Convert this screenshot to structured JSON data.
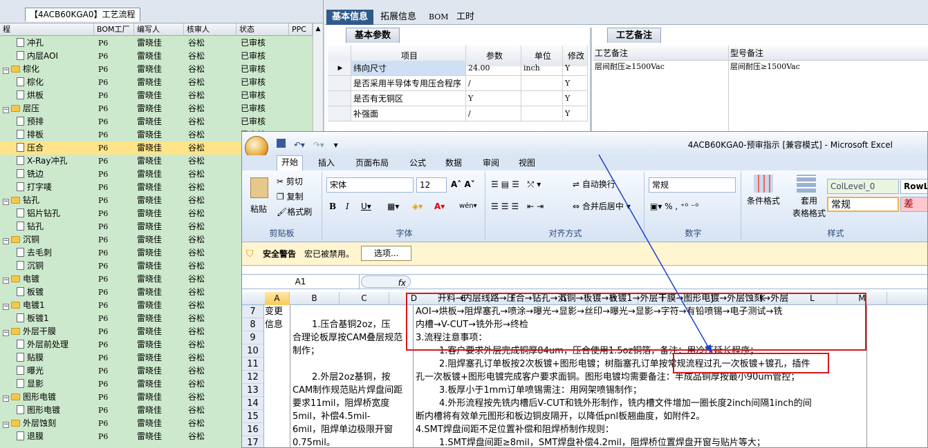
{
  "left_panel": {
    "title": "【4ACB60KGA0】工艺流程",
    "columns": [
      "程",
      "BOM工厂",
      "编写人",
      "核审人",
      "状态",
      "PPC"
    ],
    "rows": [
      {
        "name": "冲孔",
        "type": "doc",
        "indent": 2,
        "bom": "P6",
        "writer": "雷晓佳",
        "reviewer": "谷松",
        "status": "已审核"
      },
      {
        "name": "内层AOI",
        "type": "doc",
        "indent": 2,
        "bom": "P6",
        "writer": "雷晓佳",
        "reviewer": "谷松",
        "status": "已审核"
      },
      {
        "name": "棕化",
        "type": "folder",
        "indent": 1,
        "bom": "P6",
        "writer": "雷晓佳",
        "reviewer": "谷松",
        "status": "已审核"
      },
      {
        "name": "棕化",
        "type": "doc",
        "indent": 2,
        "bom": "P6",
        "writer": "雷晓佳",
        "reviewer": "谷松",
        "status": "已审核"
      },
      {
        "name": "烘板",
        "type": "doc",
        "indent": 2,
        "bom": "P6",
        "writer": "雷晓佳",
        "reviewer": "谷松",
        "status": "已审核"
      },
      {
        "name": "层压",
        "type": "folder",
        "indent": 1,
        "bom": "P6",
        "writer": "雷晓佳",
        "reviewer": "谷松",
        "status": "已审核"
      },
      {
        "name": "预排",
        "type": "doc",
        "indent": 2,
        "bom": "P6",
        "writer": "雷晓佳",
        "reviewer": "谷松",
        "status": "已审核"
      },
      {
        "name": "排板",
        "type": "doc",
        "indent": 2,
        "bom": "P6",
        "writer": "雷晓佳",
        "reviewer": "谷松",
        "status": "已审核"
      },
      {
        "name": "压合",
        "type": "doc",
        "indent": 2,
        "bom": "P6",
        "writer": "雷晓佳",
        "reviewer": "谷松",
        "status": "",
        "selected": true
      },
      {
        "name": "X-Ray冲孔",
        "type": "doc",
        "indent": 2,
        "bom": "P6",
        "writer": "雷晓佳",
        "reviewer": "谷松",
        "status": ""
      },
      {
        "name": "铣边",
        "type": "doc",
        "indent": 2,
        "bom": "P6",
        "writer": "雷晓佳",
        "reviewer": "谷松",
        "status": ""
      },
      {
        "name": "打字唛",
        "type": "doc",
        "indent": 2,
        "bom": "P6",
        "writer": "雷晓佳",
        "reviewer": "谷松",
        "status": ""
      },
      {
        "name": "钻孔",
        "type": "folder",
        "indent": 1,
        "bom": "P6",
        "writer": "雷晓佳",
        "reviewer": "谷松",
        "status": ""
      },
      {
        "name": "铝片钻孔",
        "type": "doc",
        "indent": 2,
        "bom": "P6",
        "writer": "雷晓佳",
        "reviewer": "谷松",
        "status": ""
      },
      {
        "name": "钻孔",
        "type": "doc",
        "indent": 2,
        "bom": "P6",
        "writer": "雷晓佳",
        "reviewer": "谷松",
        "status": ""
      },
      {
        "name": "沉铜",
        "type": "folder",
        "indent": 1,
        "bom": "P6",
        "writer": "雷晓佳",
        "reviewer": "谷松",
        "status": ""
      },
      {
        "name": "去毛刺",
        "type": "doc",
        "indent": 2,
        "bom": "P6",
        "writer": "雷晓佳",
        "reviewer": "谷松",
        "status": ""
      },
      {
        "name": "沉铜",
        "type": "doc",
        "indent": 2,
        "bom": "P6",
        "writer": "雷晓佳",
        "reviewer": "谷松",
        "status": ""
      },
      {
        "name": "电镀",
        "type": "folder",
        "indent": 1,
        "bom": "P6",
        "writer": "雷晓佳",
        "reviewer": "谷松",
        "status": ""
      },
      {
        "name": "板镀",
        "type": "doc",
        "indent": 2,
        "bom": "P6",
        "writer": "雷晓佳",
        "reviewer": "谷松",
        "status": ""
      },
      {
        "name": "电镀1",
        "type": "folder",
        "indent": 1,
        "bom": "P6",
        "writer": "雷晓佳",
        "reviewer": "谷松",
        "status": ""
      },
      {
        "name": "板镀1",
        "type": "doc",
        "indent": 2,
        "bom": "P6",
        "writer": "雷晓佳",
        "reviewer": "谷松",
        "status": ""
      },
      {
        "name": "外层干膜",
        "type": "folder",
        "indent": 1,
        "bom": "P6",
        "writer": "雷晓佳",
        "reviewer": "谷松",
        "status": ""
      },
      {
        "name": "外层前处理",
        "type": "doc",
        "indent": 2,
        "bom": "P6",
        "writer": "雷晓佳",
        "reviewer": "谷松",
        "status": ""
      },
      {
        "name": "贴膜",
        "type": "doc",
        "indent": 2,
        "bom": "P6",
        "writer": "雷晓佳",
        "reviewer": "谷松",
        "status": ""
      },
      {
        "name": "曝光",
        "type": "doc",
        "indent": 2,
        "bom": "P6",
        "writer": "雷晓佳",
        "reviewer": "谷松",
        "status": ""
      },
      {
        "name": "显影",
        "type": "doc",
        "indent": 2,
        "bom": "P6",
        "writer": "雷晓佳",
        "reviewer": "谷松",
        "status": ""
      },
      {
        "name": "图形电镀",
        "type": "folder",
        "indent": 1,
        "bom": "P6",
        "writer": "雷晓佳",
        "reviewer": "谷松",
        "status": ""
      },
      {
        "name": "图形电镀",
        "type": "doc",
        "indent": 2,
        "bom": "P6",
        "writer": "雷晓佳",
        "reviewer": "谷松",
        "status": ""
      },
      {
        "name": "外层蚀刻",
        "type": "folder",
        "indent": 1,
        "bom": "P6",
        "writer": "雷晓佳",
        "reviewer": "谷松",
        "status": ""
      },
      {
        "name": "退膜",
        "type": "doc",
        "indent": 2,
        "bom": "P6",
        "writer": "雷晓佳",
        "reviewer": "谷松",
        "status": ""
      }
    ]
  },
  "right_top": {
    "tabs": [
      "基本信息",
      "拓展信息",
      "BOM",
      "工时"
    ],
    "basic_params_tab": "基本参数",
    "process_notes_tab": "工艺备注",
    "param_columns": [
      "项目",
      "参数",
      "单位",
      "修改"
    ],
    "params": [
      {
        "item": "纬向尺寸",
        "value": "24.00",
        "unit": "inch",
        "flag": "Y"
      },
      {
        "item": "是否采用半导体专用压合程序",
        "value": "/",
        "unit": "",
        "flag": "Y"
      },
      {
        "item": "是否有无铜区",
        "value": "Y",
        "unit": "",
        "flag": "Y"
      },
      {
        "item": "补强面",
        "value": "/",
        "unit": "",
        "flag": "Y"
      }
    ],
    "notes_columns": [
      "工艺备注",
      "型号备注"
    ],
    "notes_values": [
      "层间耐压≥1500Vac",
      "层间耐压≥1500Vac"
    ]
  },
  "excel": {
    "title": "4ACB60KGA0-预审指示 [兼容模式] - Microsoft Excel",
    "menu": [
      "开始",
      "插入",
      "页面布局",
      "公式",
      "数据",
      "审阅",
      "视图"
    ],
    "clipboard": {
      "paste": "粘贴",
      "cut": "剪切",
      "copy": "复制",
      "format_painter": "格式刷",
      "label": "剪贴板"
    },
    "font": {
      "name": "宋体",
      "size": "12",
      "label": "字体"
    },
    "alignment": {
      "wrap": "自动换行",
      "merge": "合并后居中",
      "label": "对齐方式"
    },
    "number": {
      "format": "常规",
      "label": "数字"
    },
    "styles": {
      "conditional": "条件格式",
      "table": "套用",
      "table2": "表格格式",
      "label": "样式",
      "s1": "ColLevel_0",
      "s2": "RowL",
      "s3": "常规",
      "s4": "差"
    },
    "security": {
      "title": "安全警告",
      "message": "宏已被禁用。",
      "options": "选项..."
    },
    "name_box": "A1",
    "fx": "fx",
    "col_headers": [
      "A",
      "B",
      "C",
      "D",
      "E",
      "F",
      "G",
      "H",
      "I",
      "J",
      "K",
      "L",
      "M"
    ],
    "row_numbers": [
      "7",
      "8",
      "9",
      "10",
      "11",
      "12",
      "13",
      "14",
      "15",
      "16",
      "17"
    ],
    "cells": {
      "a_label1": "变更",
      "a_label2": "信息",
      "b_lines": [
        "1.压合基铜2oz，压",
        "合理论板厚按CAM叠层规范",
        "制作；",
        "2.外层2oz基铜，按",
        "CAM制作规范贴片焊盘间距",
        "要求11mil，阻焊桥宽度",
        "5mil，补偿4.5mil-",
        "6mil，阻焊单边极限开窗",
        "0.75mil。"
      ],
      "d_lines": [
        "开料→内层线路→压合→钻孔→沉铜→板镀→板镀1→外层干膜→图形电镀→外层蚀刻→外层",
        "AOI→烘板→阻焊塞孔→喷涂→曝光→显影→丝印→曝光→显影→字符→有铅喷锡→电子测试→铣",
        "内槽→V-CUT→铣外形→终检",
        "3.流程注意事项：",
        "1.客户要求外层完成铜厚84um，压合使用1.5oz铜箔，备注：用冷压延长程序；",
        "2.阻焊塞孔订单板按2次板镀+图形电镀；树脂塞孔订单按常规流程过孔一次板镀+镀孔，插件",
        "孔一次板镀+图形电镀完成客户要求面铜。图形电镀均需要备注：半成品铜厚按最小90um管控；",
        "3.板厚小于1mm订单喷锡需注：用网架喷锡制作；",
        "4.外形流程按先铣内槽后V-CUT和铣外形制作，铣内槽文件增加一圈长度2inch间隔1inch的间",
        "断内槽将有效单元图形和板边铜皮隔开，以降低pnl板翘曲度，如附件2。",
        "4.SMT焊盘间距不足位置补偿和阻焊桥制作规则：",
        "1.SMT焊盘间距≥8mil，SMT焊盘补偿4.2mil，阻焊桥位置焊盘开窗与贴片等大；"
      ]
    }
  }
}
